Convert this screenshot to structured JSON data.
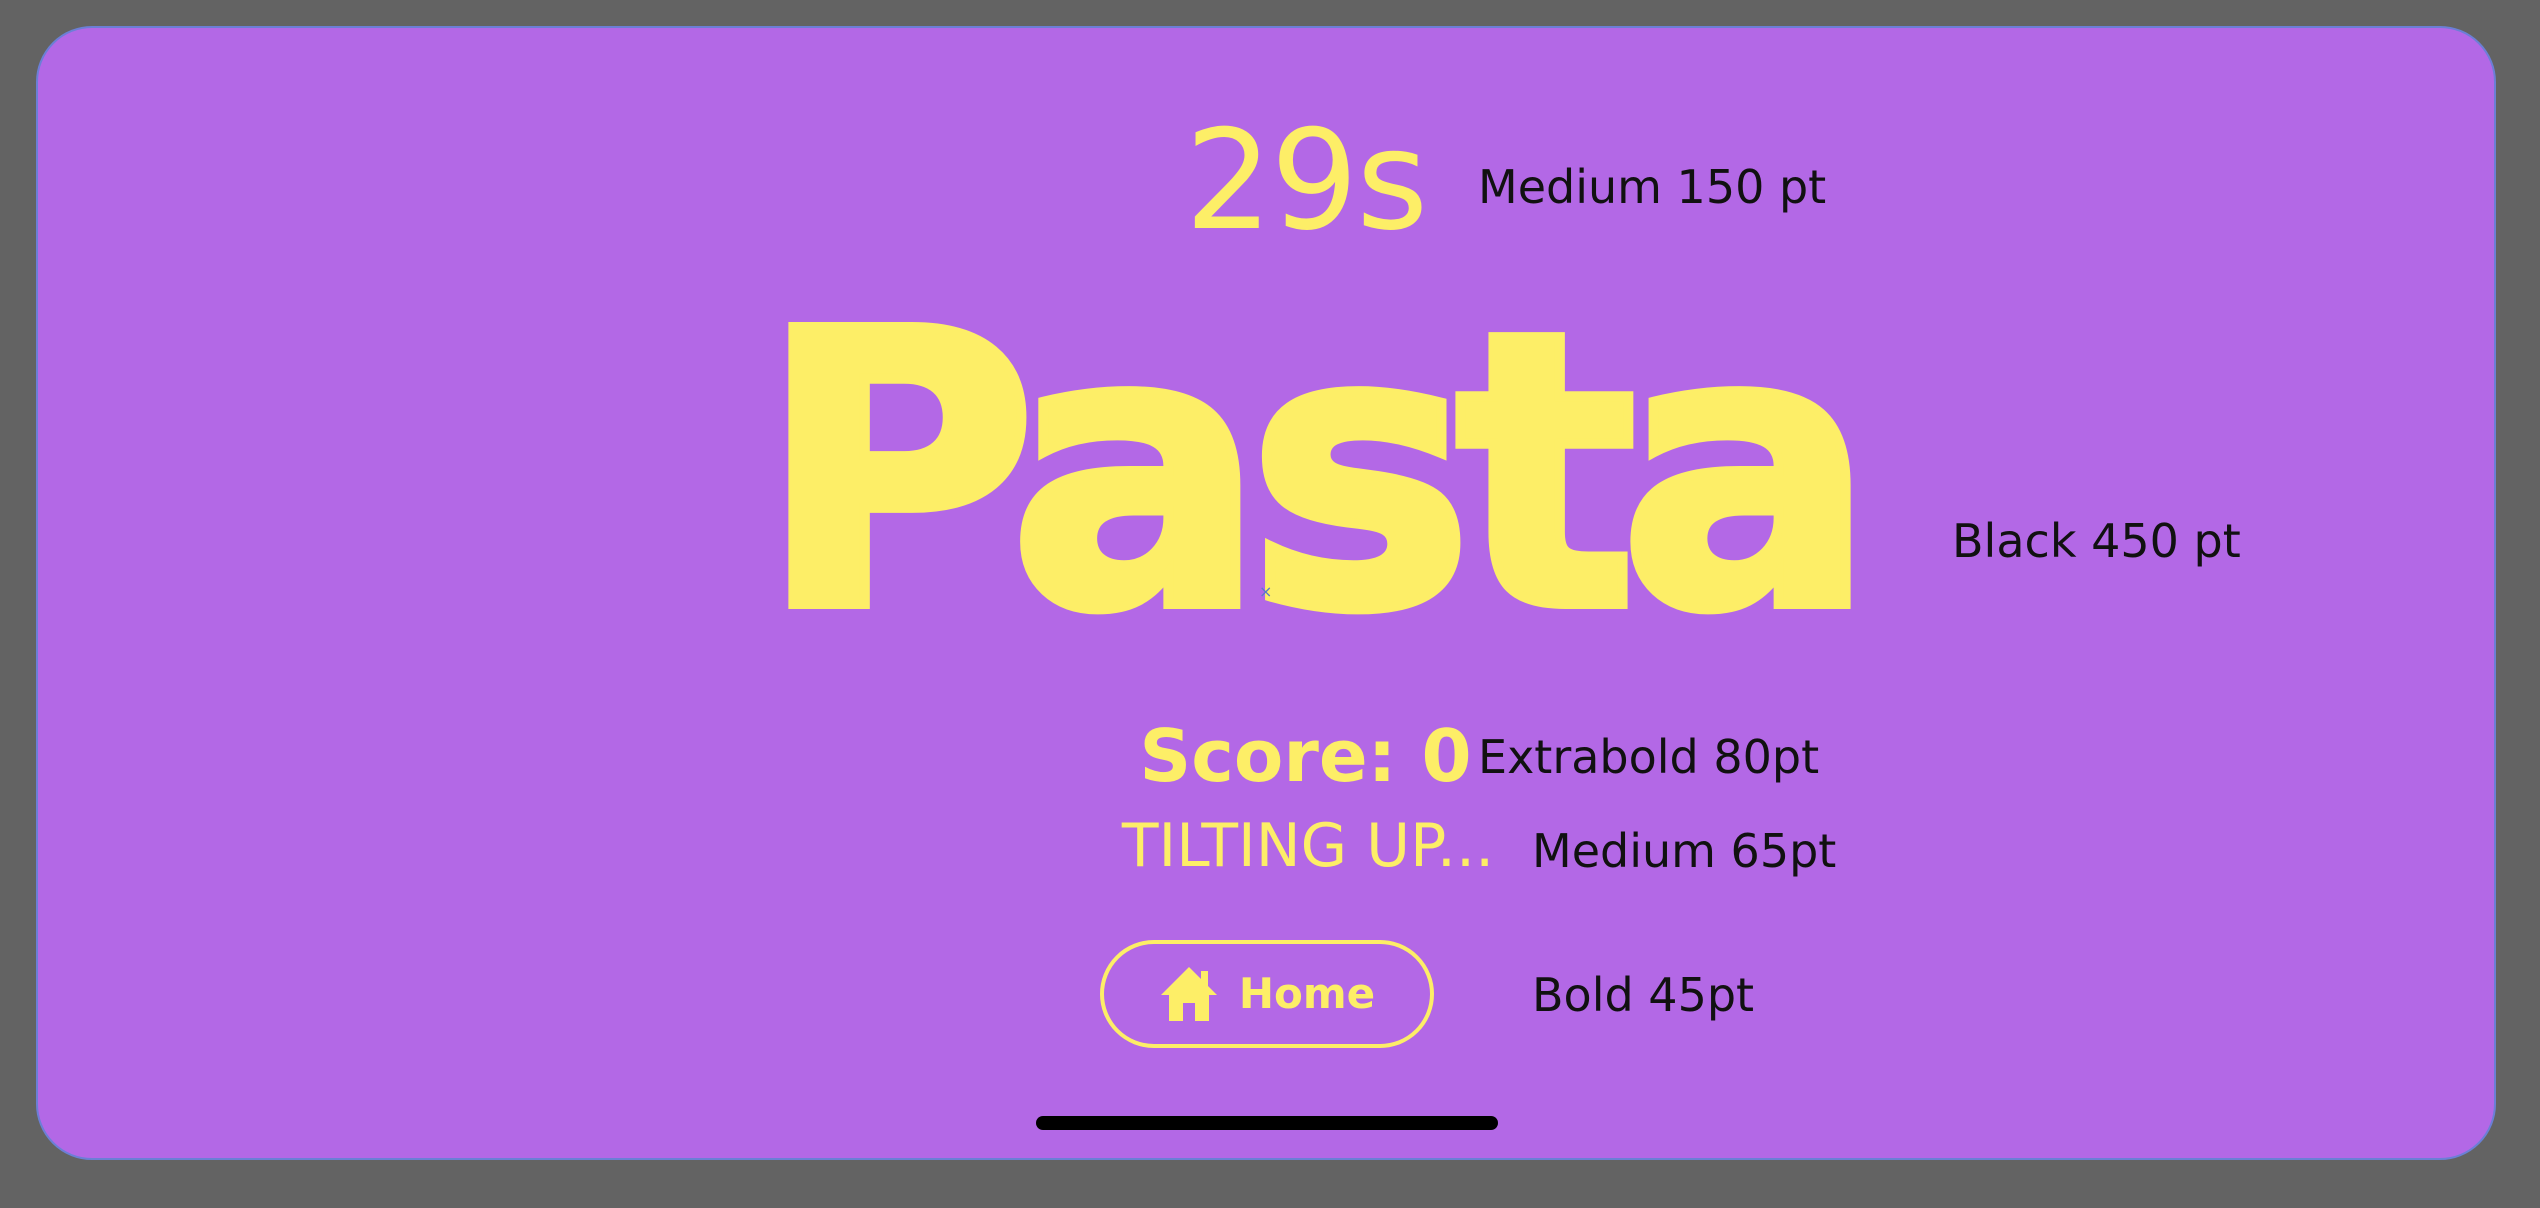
{
  "game": {
    "timer": "29s",
    "word": "Pasta",
    "score": "Score: 0",
    "status": "TILTING UP...",
    "home_button": {
      "label": "Home",
      "icon": "home-icon"
    }
  },
  "annotations": {
    "timer": "Medium 150 pt",
    "word": "Black 450 pt",
    "score": "Extrabold 80pt",
    "status": "Medium 65pt",
    "button": "Bold 45pt"
  },
  "colors": {
    "background": "#b368e6",
    "accent": "#fdee67",
    "frame": "#636363",
    "annotation_text": "#111111"
  }
}
